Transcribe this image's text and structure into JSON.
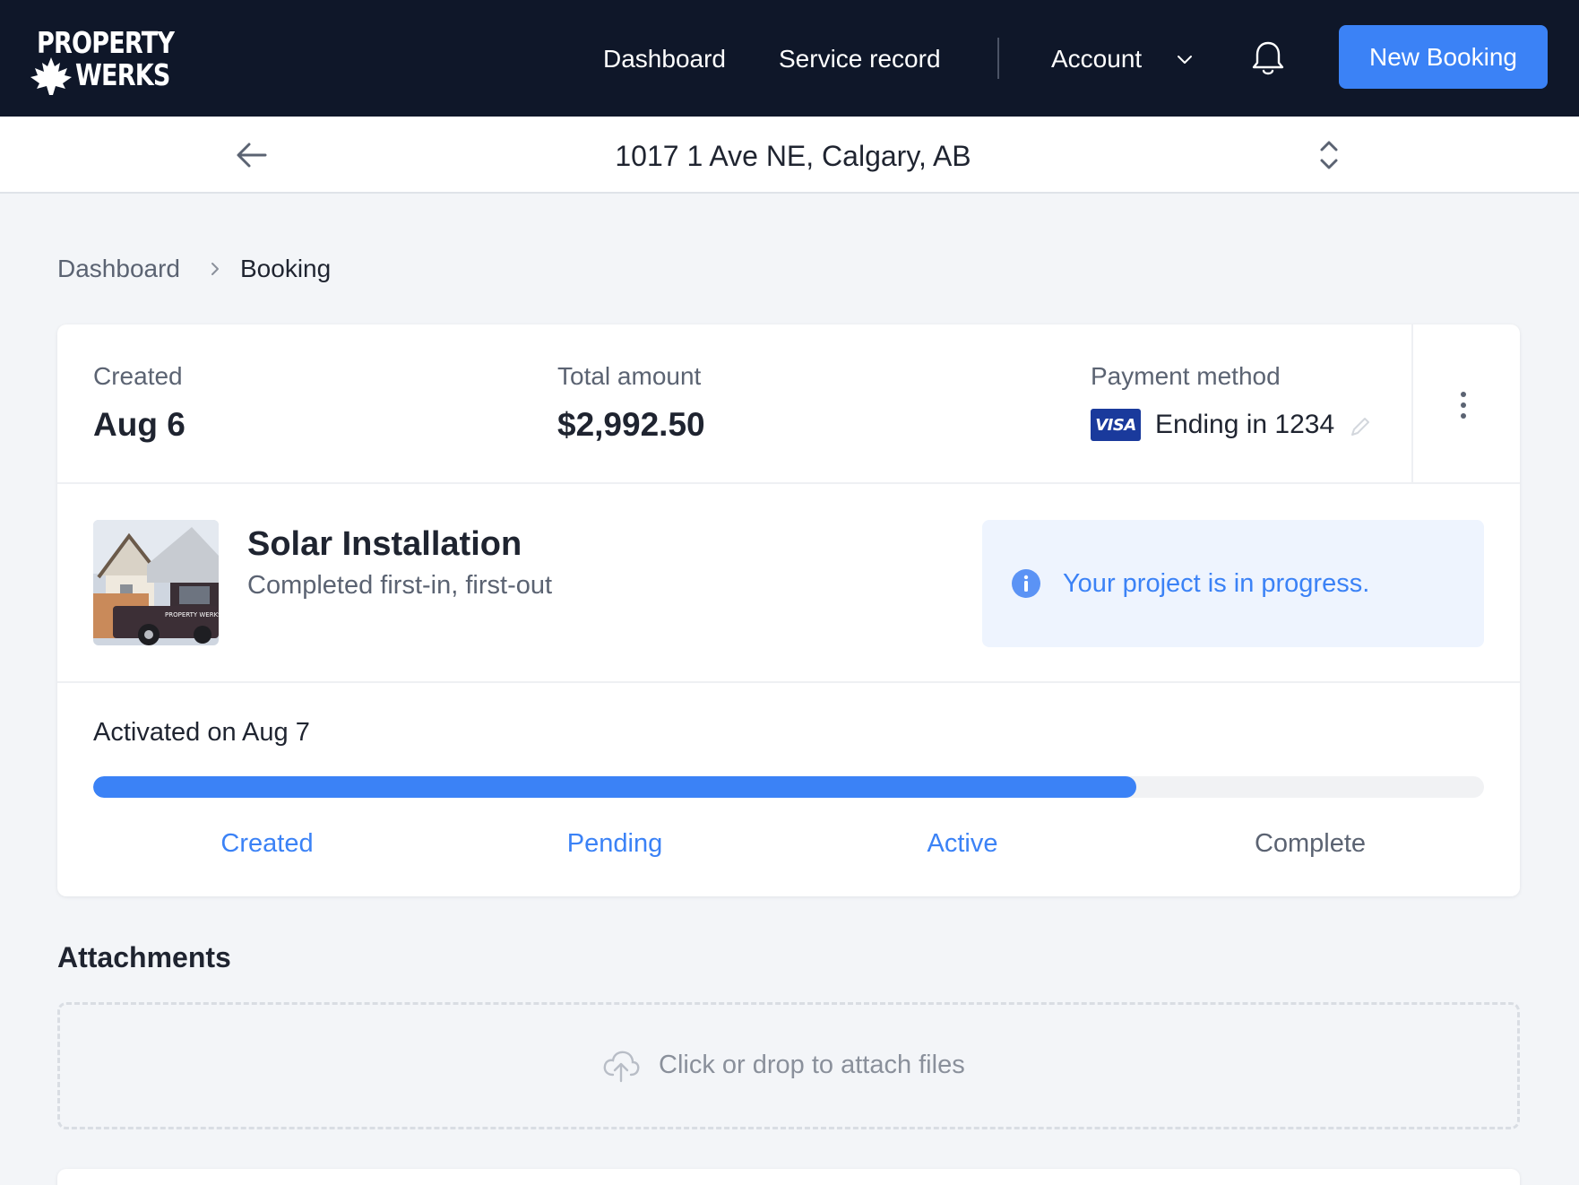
{
  "brand": {
    "line1": "PROPERTY",
    "line2": "WERKS"
  },
  "nav": {
    "dashboard": "Dashboard",
    "service_record": "Service record",
    "account": "Account",
    "new_booking": "New Booking"
  },
  "address_bar": {
    "address": "1017 1 Ave NE, Calgary, AB"
  },
  "breadcrumb": {
    "parent": "Dashboard",
    "current": "Booking"
  },
  "summary": {
    "created_label": "Created",
    "created_value": "Aug 6",
    "total_label": "Total amount",
    "total_value": "$2,992.50",
    "payment_label": "Payment method",
    "card_brand": "VISA",
    "payment_value": "Ending in 1234"
  },
  "service": {
    "title": "Solar Installation",
    "subtitle": "Completed first-in, first-out",
    "truck_text": "PROPERTY WERKS"
  },
  "info": {
    "message": "Your project is in progress."
  },
  "progress": {
    "activated": "Activated on Aug 7",
    "fraction": 0.75,
    "steps": [
      {
        "label": "Created",
        "state": "done"
      },
      {
        "label": "Pending",
        "state": "done"
      },
      {
        "label": "Active",
        "state": "done"
      },
      {
        "label": "Complete",
        "state": "todo"
      }
    ]
  },
  "attachments": {
    "title": "Attachments",
    "drop_text": "Click or drop to attach files"
  },
  "colors": {
    "nav_bg": "#0f1729",
    "accent": "#3b82f6",
    "info_bg": "#eef4fe",
    "visa_blue": "#1a3a9c",
    "muted_text": "#5b6372"
  },
  "icons": [
    "maple-leaf-icon",
    "chevron-down-icon",
    "bell-icon",
    "arrow-left-icon",
    "chevron-updown-icon",
    "chevron-right-icon",
    "pencil-icon",
    "kebab-icon",
    "info-icon",
    "cloud-upload-icon"
  ]
}
